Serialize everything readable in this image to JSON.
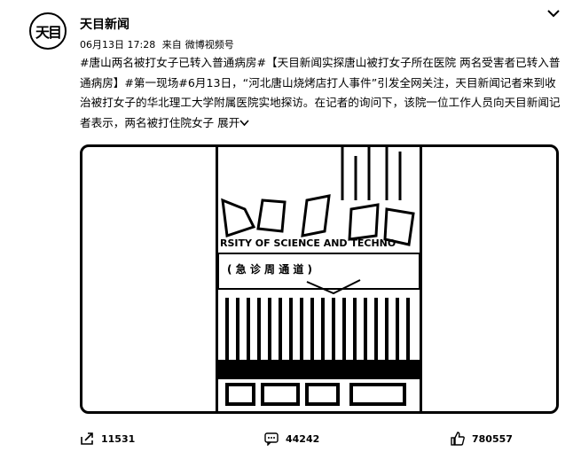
{
  "post": {
    "avatar_text": "天目",
    "author": "天目新闻",
    "date": "06月13日 17:28",
    "source_prefix": "来自",
    "source": "微博视频号",
    "text": "#唐山两名被打女子已转入普通病房#【天目新闻实探唐山被打女子所在医院 两名受害者已转入普通病房】#第一现场#6月13日，“河北唐山烧烤店打人事件”引发全网关注，天目新闻记者来到收治被打女子的华北理工大学附属医院实地探访。在记者的询问下，该院一位工作人员向天目新闻记者表示，两名被打住院女子",
    "expand_label": "展开"
  },
  "video": {
    "sign_text_1": "RSITY OF SCIENCE AND TECHNO",
    "sign_text_2": "( 急  诊   周  通  道 )"
  },
  "footer": {
    "repost_count": "11531",
    "comment_count": "44242",
    "like_count": "780557"
  },
  "icons": {
    "menu": "chevron-down-icon",
    "share": "share-icon",
    "comment": "comment-icon",
    "like": "like-icon"
  }
}
